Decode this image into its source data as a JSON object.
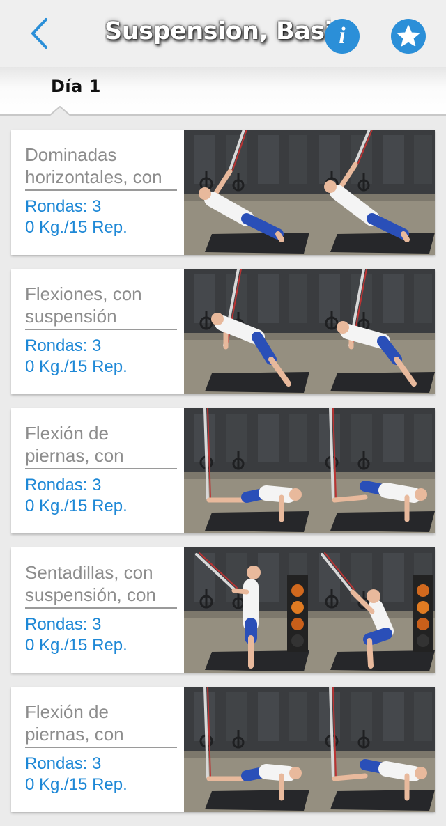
{
  "header": {
    "title": "Suspension, Basico",
    "back_icon": "chevron-left-icon",
    "info_icon": "info-icon",
    "favorite_icon": "star-icon",
    "accent_color": "#2b8fd8"
  },
  "tabs": [
    {
      "label": "Día 1",
      "selected": true
    }
  ],
  "exercises": [
    {
      "name": "Dominadas horizontales, con",
      "rounds": "Rondas: 3",
      "reps": "0 Kg./15 Rep.",
      "pose": "row"
    },
    {
      "name": "Flexiones, con suspensión",
      "rounds": "Rondas: 3",
      "reps": "0 Kg./15 Rep.",
      "pose": "pushup"
    },
    {
      "name": "Flexión de piernas, con",
      "rounds": "Rondas: 3",
      "reps": "0 Kg./15 Rep.",
      "pose": "legcurl"
    },
    {
      "name": "Sentadillas, con suspensión, con",
      "rounds": "Rondas: 3",
      "reps": "0 Kg./15 Rep.",
      "pose": "squat"
    },
    {
      "name": "Flexión de piernas, con",
      "rounds": "Rondas: 3",
      "reps": "0 Kg./15 Rep.",
      "pose": "legcurl"
    }
  ]
}
